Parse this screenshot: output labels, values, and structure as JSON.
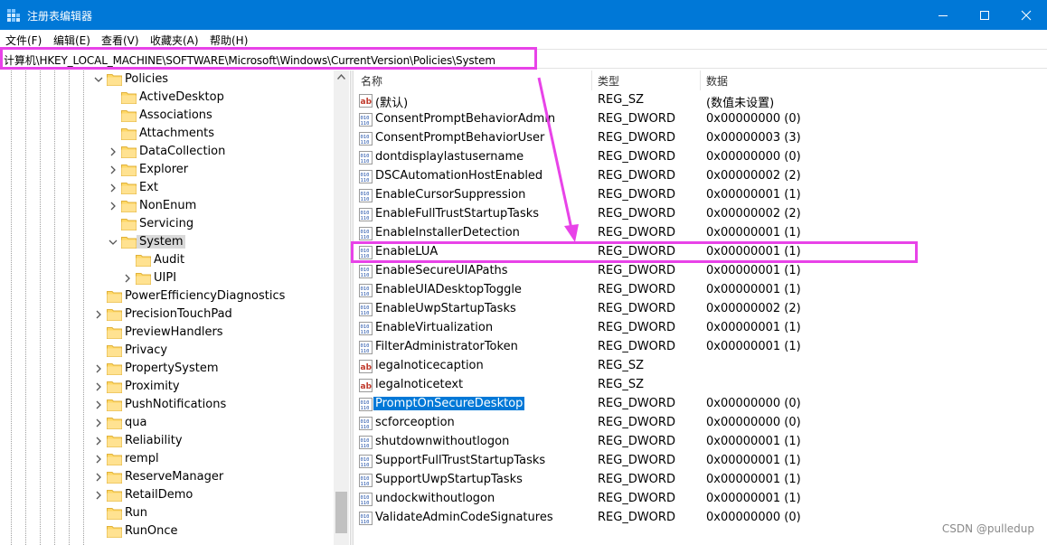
{
  "window": {
    "title": "注册表编辑器",
    "controls": [
      "minimize",
      "maximize",
      "close"
    ],
    "accent": "#0078d7"
  },
  "menu": [
    "文件(F)",
    "编辑(E)",
    "查看(V)",
    "收藏夹(A)",
    "帮助(H)"
  ],
  "address": "计算机\\HKEY_LOCAL_MACHINE\\SOFTWARE\\Microsoft\\Windows\\CurrentVersion\\Policies\\System",
  "tree": [
    {
      "label": "Policies",
      "expander": "expanded",
      "level": 1
    },
    {
      "label": "ActiveDesktop",
      "expander": "none",
      "level": 2
    },
    {
      "label": "Associations",
      "expander": "none",
      "level": 2
    },
    {
      "label": "Attachments",
      "expander": "none",
      "level": 2
    },
    {
      "label": "DataCollection",
      "expander": "collapsed",
      "level": 2
    },
    {
      "label": "Explorer",
      "expander": "collapsed",
      "level": 2
    },
    {
      "label": "Ext",
      "expander": "collapsed",
      "level": 2
    },
    {
      "label": "NonEnum",
      "expander": "collapsed",
      "level": 2
    },
    {
      "label": "Servicing",
      "expander": "none",
      "level": 2
    },
    {
      "label": "System",
      "expander": "expanded",
      "level": 2,
      "selected": true
    },
    {
      "label": "Audit",
      "expander": "none",
      "level": 3
    },
    {
      "label": "UIPI",
      "expander": "collapsed",
      "level": 3
    },
    {
      "label": "PowerEfficiencyDiagnostics",
      "expander": "none",
      "level": 1
    },
    {
      "label": "PrecisionTouchPad",
      "expander": "collapsed",
      "level": 1
    },
    {
      "label": "PreviewHandlers",
      "expander": "none",
      "level": 1
    },
    {
      "label": "Privacy",
      "expander": "none",
      "level": 1
    },
    {
      "label": "PropertySystem",
      "expander": "collapsed",
      "level": 1
    },
    {
      "label": "Proximity",
      "expander": "collapsed",
      "level": 1
    },
    {
      "label": "PushNotifications",
      "expander": "collapsed",
      "level": 1
    },
    {
      "label": "qua",
      "expander": "collapsed",
      "level": 1
    },
    {
      "label": "Reliability",
      "expander": "collapsed",
      "level": 1
    },
    {
      "label": "rempl",
      "expander": "collapsed",
      "level": 1
    },
    {
      "label": "ReserveManager",
      "expander": "collapsed",
      "level": 1
    },
    {
      "label": "RetailDemo",
      "expander": "collapsed",
      "level": 1
    },
    {
      "label": "Run",
      "expander": "none",
      "level": 1
    },
    {
      "label": "RunOnce",
      "expander": "none",
      "level": 1
    }
  ],
  "list": {
    "columns": [
      "名称",
      "类型",
      "数据"
    ],
    "rows": [
      {
        "icon": "string-value-icon",
        "name": "(默认)",
        "type": "REG_SZ",
        "data": "(数值未设置)"
      },
      {
        "icon": "binary-value-icon",
        "name": "ConsentPromptBehaviorAdmin",
        "type": "REG_DWORD",
        "data": "0x00000000 (0)"
      },
      {
        "icon": "binary-value-icon",
        "name": "ConsentPromptBehaviorUser",
        "type": "REG_DWORD",
        "data": "0x00000003 (3)"
      },
      {
        "icon": "binary-value-icon",
        "name": "dontdisplaylastusername",
        "type": "REG_DWORD",
        "data": "0x00000000 (0)"
      },
      {
        "icon": "binary-value-icon",
        "name": "DSCAutomationHostEnabled",
        "type": "REG_DWORD",
        "data": "0x00000002 (2)"
      },
      {
        "icon": "binary-value-icon",
        "name": "EnableCursorSuppression",
        "type": "REG_DWORD",
        "data": "0x00000001 (1)"
      },
      {
        "icon": "binary-value-icon",
        "name": "EnableFullTrustStartupTasks",
        "type": "REG_DWORD",
        "data": "0x00000002 (2)"
      },
      {
        "icon": "binary-value-icon",
        "name": "EnableInstallerDetection",
        "type": "REG_DWORD",
        "data": "0x00000001 (1)"
      },
      {
        "icon": "binary-value-icon",
        "name": "EnableLUA",
        "type": "REG_DWORD",
        "data": "0x00000001 (1)",
        "highlighted": true
      },
      {
        "icon": "binary-value-icon",
        "name": "EnableSecureUIAPaths",
        "type": "REG_DWORD",
        "data": "0x00000001 (1)"
      },
      {
        "icon": "binary-value-icon",
        "name": "EnableUIADesktopToggle",
        "type": "REG_DWORD",
        "data": "0x00000001 (1)"
      },
      {
        "icon": "binary-value-icon",
        "name": "EnableUwpStartupTasks",
        "type": "REG_DWORD",
        "data": "0x00000002 (2)"
      },
      {
        "icon": "binary-value-icon",
        "name": "EnableVirtualization",
        "type": "REG_DWORD",
        "data": "0x00000001 (1)"
      },
      {
        "icon": "binary-value-icon",
        "name": "FilterAdministratorToken",
        "type": "REG_DWORD",
        "data": "0x00000001 (1)"
      },
      {
        "icon": "string-value-icon",
        "name": "legalnoticecaption",
        "type": "REG_SZ",
        "data": ""
      },
      {
        "icon": "string-value-icon",
        "name": "legalnoticetext",
        "type": "REG_SZ",
        "data": ""
      },
      {
        "icon": "binary-value-icon",
        "name": "PromptOnSecureDesktop",
        "type": "REG_DWORD",
        "data": "0x00000000 (0)",
        "selected": true
      },
      {
        "icon": "binary-value-icon",
        "name": "scforceoption",
        "type": "REG_DWORD",
        "data": "0x00000000 (0)"
      },
      {
        "icon": "binary-value-icon",
        "name": "shutdownwithoutlogon",
        "type": "REG_DWORD",
        "data": "0x00000001 (1)"
      },
      {
        "icon": "binary-value-icon",
        "name": "SupportFullTrustStartupTasks",
        "type": "REG_DWORD",
        "data": "0x00000001 (1)"
      },
      {
        "icon": "binary-value-icon",
        "name": "SupportUwpStartupTasks",
        "type": "REG_DWORD",
        "data": "0x00000001 (1)"
      },
      {
        "icon": "binary-value-icon",
        "name": "undockwithoutlogon",
        "type": "REG_DWORD",
        "data": "0x00000001 (1)"
      },
      {
        "icon": "binary-value-icon",
        "name": "ValidateAdminCodeSignatures",
        "type": "REG_DWORD",
        "data": "0x00000000 (0)"
      }
    ]
  },
  "annotation": {
    "color": "#e843e8"
  },
  "watermark": "CSDN @pulledup"
}
